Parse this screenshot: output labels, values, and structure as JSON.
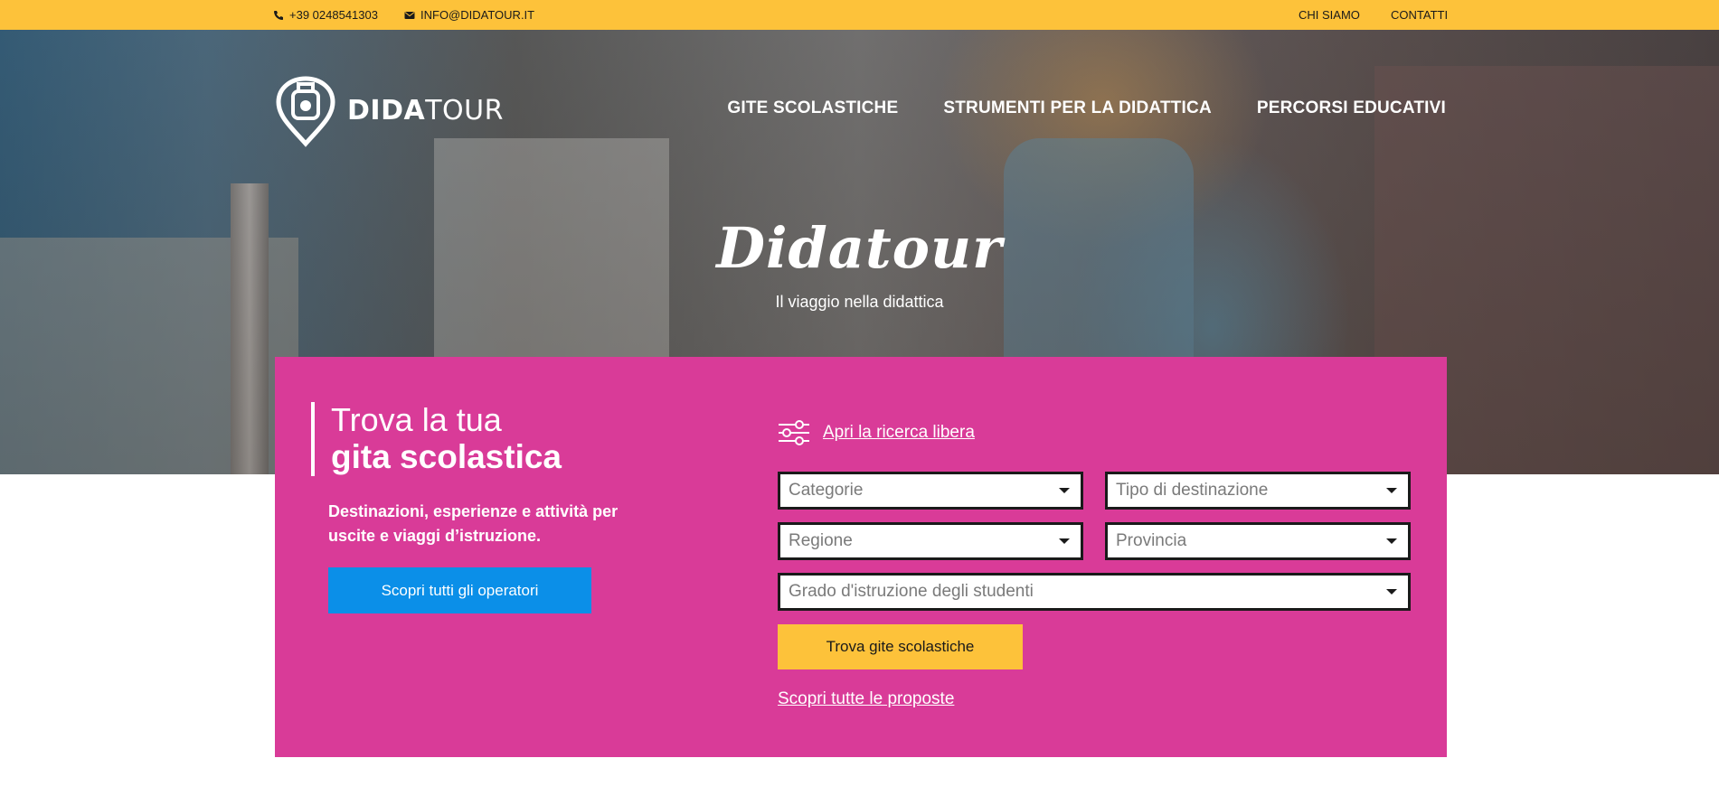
{
  "topbar": {
    "phone": "+39 0248541303",
    "email": "INFO@DIDATOUR.IT",
    "links": [
      "CHI SIAMO",
      "CONTATTI"
    ]
  },
  "header": {
    "logo_bold": "DIDA",
    "logo_light": "TOUR",
    "nav": [
      "GITE SCOLASTICHE",
      "STRUMENTI PER LA DIDATTICA",
      "PERCORSI EDUCATIVI"
    ]
  },
  "hero": {
    "title": "Didatour",
    "subtitle": "Il viaggio nella didattica"
  },
  "search_panel": {
    "heading_line1": "Trova la tua",
    "heading_line2": "gita scolastica",
    "description": "Destinazioni, esperienze e attività per uscite e viaggi d’istruzione.",
    "operators_button": "Scopri tutti gli operatori",
    "free_search_link": "Apri la ricerca libera",
    "selects": {
      "categorie": "Categorie",
      "tipo": "Tipo di destinazione",
      "regione": "Regione",
      "provincia": "Provincia",
      "grado": "Grado d'istruzione degli studenti"
    },
    "find_button": "Trova gite scolastiche",
    "all_proposals_link": "Scopri tutte le proposte"
  },
  "colors": {
    "yellow": "#fdc23a",
    "pink": "#d93b98",
    "blue": "#0b8fe8"
  }
}
